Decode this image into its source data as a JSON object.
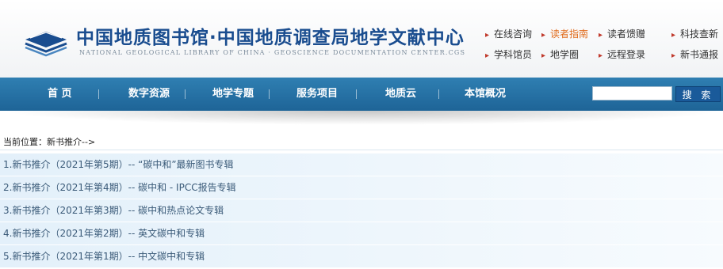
{
  "header": {
    "title": "中国地质图书馆·中国地质调查局地学文献中心",
    "subtitle": "NATIONAL GEOLOGICAL LIBRARY OF CHINA · GEOSCIENCE DOCUMENTATION CENTER.CGS",
    "quick_links": [
      {
        "label": "在线咨询"
      },
      {
        "label": "读者指南",
        "active": true
      },
      {
        "label": "读者馈赠"
      },
      {
        "label": "科技查新"
      },
      {
        "label": "学科馆员"
      },
      {
        "label": "地学圈"
      },
      {
        "label": "远程登录"
      },
      {
        "label": "新书通报"
      }
    ]
  },
  "nav": {
    "items": [
      "首 页",
      "数字资源",
      "地学专题",
      "服务项目",
      "地质云",
      "本馆概况"
    ],
    "search_placeholder": "",
    "search_button": "搜 索"
  },
  "breadcrumb": "当前位置：新书推介-->",
  "list": [
    "1.新书推介（2021年第5期）-- “碳中和”最新图书专辑",
    "2.新书推介（2021年第4期）-- 碳中和 - IPCC报告专辑",
    "3.新书推介（2021年第3期）-- 碳中和热点论文专辑",
    "4.新书推介（2021年第2期）-- 英文碳中和专辑",
    "5.新书推介（2021年第1期）-- 中文碳中和专辑"
  ],
  "colors": {
    "brand": "#1a4d8f",
    "nav": "#2a72a8",
    "active_link": "#e06a1a",
    "arrow": "#c0392b"
  }
}
